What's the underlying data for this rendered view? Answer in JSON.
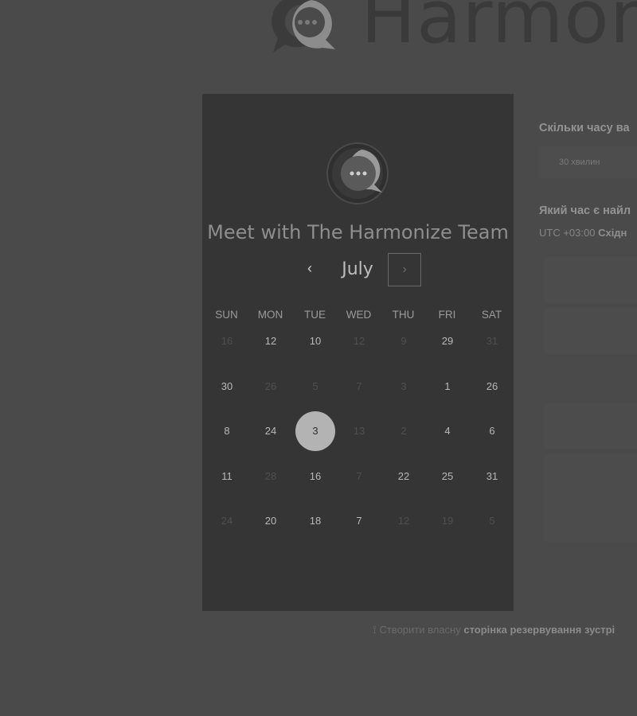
{
  "colors": {
    "page_bg": "#4a4a4a",
    "calendar_bg": "#353535",
    "selected_day_bg": "#b3b3b3"
  },
  "brand": {
    "logo_text": "Harmon"
  },
  "calendar": {
    "title": "Meet with The Harmonize Team",
    "month": "July",
    "prev_icon": "chevron-left-icon",
    "next_icon": "chevron-right-icon",
    "weekdays": [
      "SUN",
      "MON",
      "TUE",
      "WED",
      "THU",
      "FRI",
      "SAT"
    ],
    "weeks": [
      [
        {
          "label": "16",
          "available": false
        },
        {
          "label": "12",
          "available": true
        },
        {
          "label": "10",
          "available": true
        },
        {
          "label": "12",
          "available": false
        },
        {
          "label": "9",
          "available": false
        },
        {
          "label": "29",
          "available": true
        },
        {
          "label": "31",
          "available": false
        }
      ],
      [
        {
          "label": "30",
          "available": true
        },
        {
          "label": "26",
          "available": false
        },
        {
          "label": "5",
          "available": false
        },
        {
          "label": "7",
          "available": false
        },
        {
          "label": "3",
          "available": false
        },
        {
          "label": "1",
          "available": true
        },
        {
          "label": "26",
          "available": true
        }
      ],
      [
        {
          "label": "8",
          "available": true
        },
        {
          "label": "24",
          "available": true
        },
        {
          "label": "3",
          "available": true,
          "selected": true
        },
        {
          "label": "13",
          "available": false
        },
        {
          "label": "2",
          "available": false
        },
        {
          "label": "4",
          "available": true
        },
        {
          "label": "6",
          "available": true
        }
      ],
      [
        {
          "label": "11",
          "available": true
        },
        {
          "label": "28",
          "available": false
        },
        {
          "label": "16",
          "available": true
        },
        {
          "label": "7",
          "available": false
        },
        {
          "label": "22",
          "available": true
        },
        {
          "label": "25",
          "available": true
        },
        {
          "label": "31",
          "available": true
        }
      ],
      [
        {
          "label": "24",
          "available": false
        },
        {
          "label": "20",
          "available": true
        },
        {
          "label": "18",
          "available": true
        },
        {
          "label": "7",
          "available": true
        },
        {
          "label": "12",
          "available": false
        },
        {
          "label": "19",
          "available": false
        },
        {
          "label": "5",
          "available": false
        }
      ]
    ]
  },
  "booking": {
    "duration_question": "Скільки часу ва",
    "duration_value": "30 хвилин",
    "time_question": "Який час є найл",
    "timezone_offset": "UTC +03:00",
    "timezone_name": "Східн"
  },
  "footer": {
    "icon": "wand-icon",
    "prefix": "Створити власну",
    "link": "сторінка резервування зустрі"
  }
}
